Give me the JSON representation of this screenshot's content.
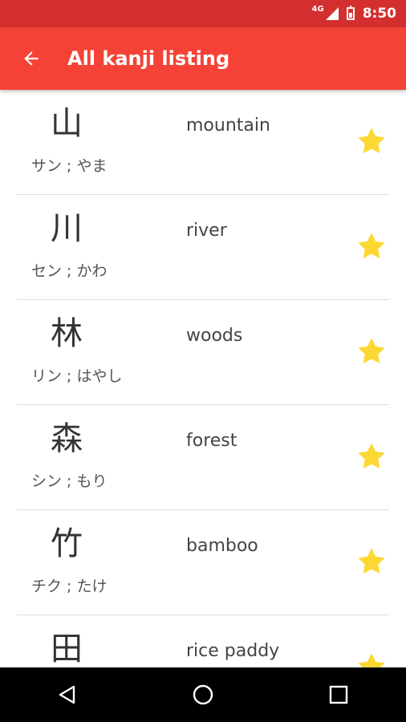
{
  "status_bar": {
    "network": "4G",
    "time": "8:50"
  },
  "app_bar": {
    "title": "All kanji listing",
    "back_icon": "arrow-back-icon",
    "color": "#f44336"
  },
  "kanji": [
    {
      "character": "山",
      "reading": "サン ; やま",
      "meaning": "mountain",
      "favorite": true
    },
    {
      "character": "川",
      "reading": "セン ; かわ",
      "meaning": "river",
      "favorite": true
    },
    {
      "character": "林",
      "reading": "リン ; はやし",
      "meaning": "woods",
      "favorite": true
    },
    {
      "character": "森",
      "reading": "シン ; もり",
      "meaning": "forest",
      "favorite": true
    },
    {
      "character": "竹",
      "reading": "チク ; たけ",
      "meaning": "bamboo",
      "favorite": true
    },
    {
      "character": "田",
      "reading": "",
      "meaning": "rice paddy",
      "favorite": true
    }
  ],
  "colors": {
    "status_bar": "#d32f2f",
    "star": "#fdd835"
  },
  "nav": {
    "back_icon": "triangle-back-icon",
    "home_icon": "circle-home-icon",
    "recents_icon": "square-recents-icon"
  }
}
